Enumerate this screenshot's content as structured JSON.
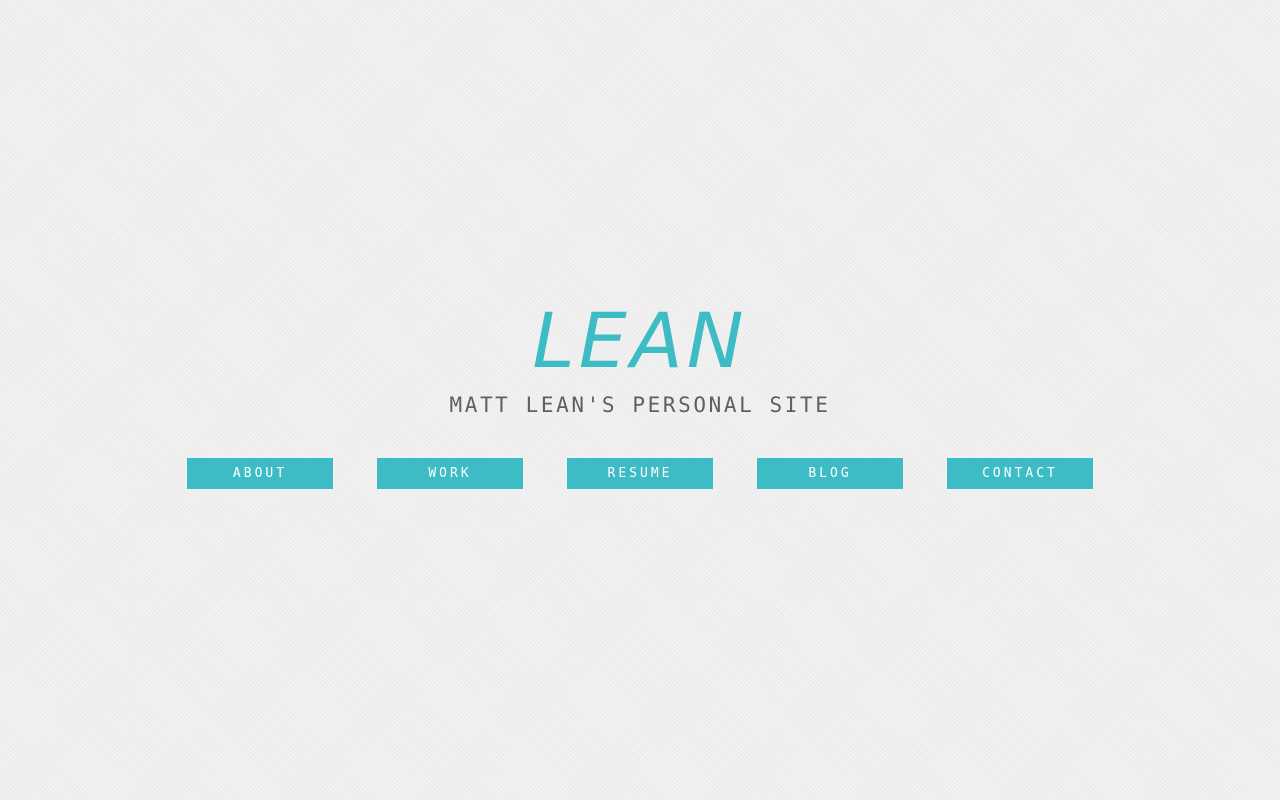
{
  "site": {
    "logo": "LEAN",
    "tagline": "MATT LEAN'S PERSONAL SITE"
  },
  "nav": {
    "items": [
      {
        "label": "ABOUT"
      },
      {
        "label": "WORK"
      },
      {
        "label": "RESUME"
      },
      {
        "label": "BLOG"
      },
      {
        "label": "CONTACT"
      }
    ]
  },
  "colors": {
    "accent": "#3dbcc6",
    "background": "#efefef",
    "tagline": "#5f5f5f",
    "button_text": "#ffffff"
  }
}
